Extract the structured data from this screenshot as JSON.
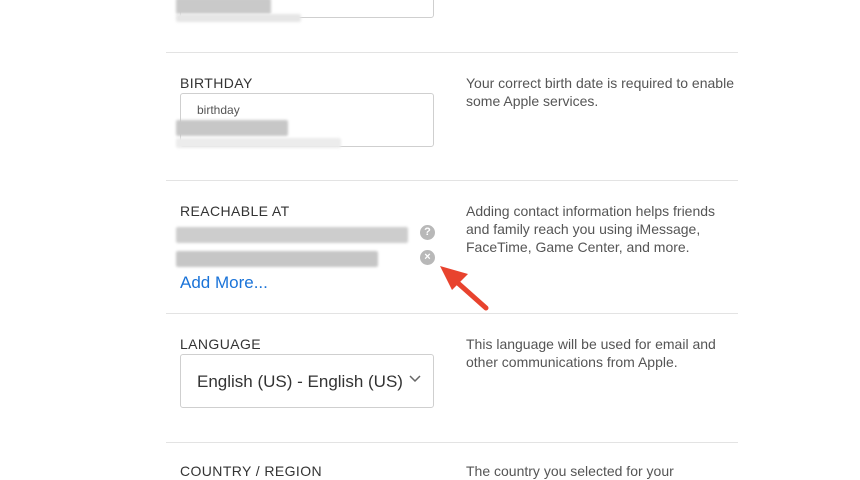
{
  "birthday": {
    "label": "BIRTHDAY",
    "field_placeholder": "birthday",
    "help": "Your correct birth date is required to enable some Apple services."
  },
  "reachable": {
    "label": "REACHABLE AT",
    "add_more": "Add More...",
    "help": "Adding contact information helps friends and family reach you using iMessage, FaceTime, Game Center, and more.",
    "icons": [
      "question-icon",
      "remove-icon"
    ]
  },
  "language": {
    "label": "LANGUAGE",
    "value": "English (US) - English (US)",
    "help": "This language will be used for email and other communications from Apple."
  },
  "country": {
    "label": "COUNTRY / REGION",
    "help": "The country you selected for your"
  },
  "colors": {
    "accent": "#1a73d8",
    "annotation_arrow": "#e8432e"
  }
}
